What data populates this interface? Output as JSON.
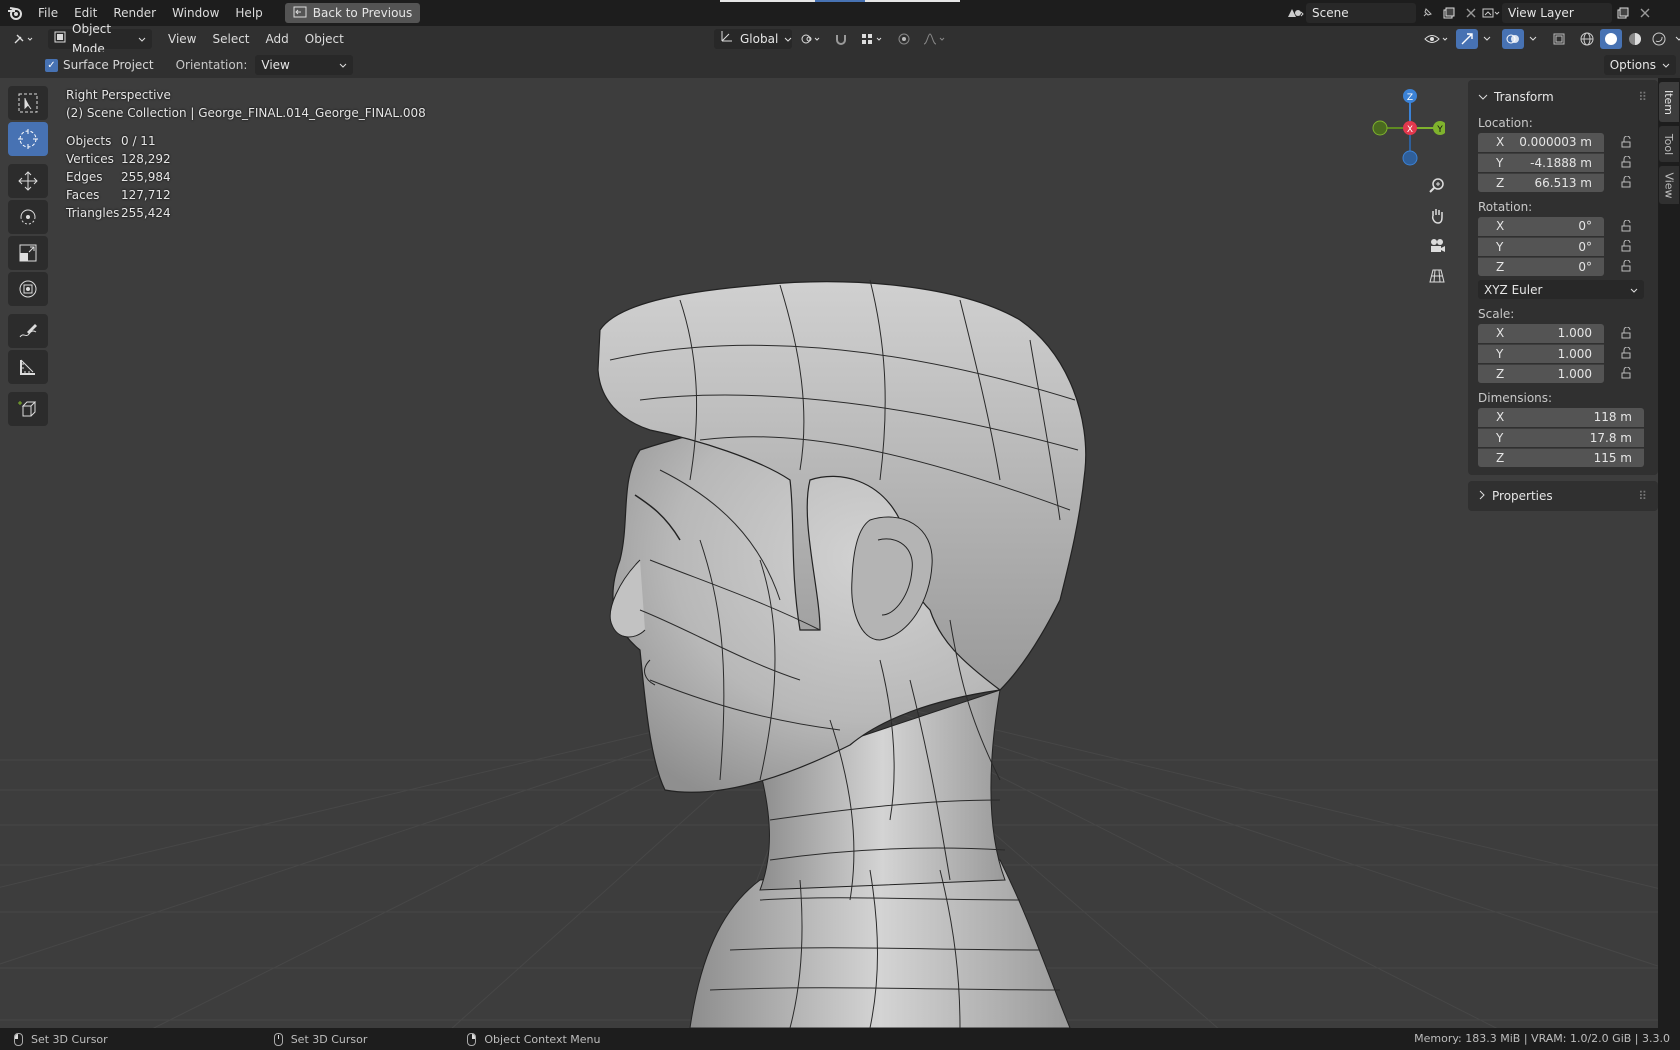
{
  "menu": {
    "items": [
      "File",
      "Edit",
      "Render",
      "Window",
      "Help"
    ],
    "back_button": "Back to Previous"
  },
  "scene": {
    "name": "Scene"
  },
  "view_layer": {
    "name": "View Layer"
  },
  "viewport_header": {
    "mode": "Object Mode",
    "menus": [
      "View",
      "Select",
      "Add",
      "Object"
    ],
    "transform_orientation": "Global"
  },
  "tool_options": {
    "surface_project_label": "Surface Project",
    "surface_project_checked": true,
    "orientation_label": "Orientation:",
    "orientation_value": "View",
    "options_label": "Options"
  },
  "overlay": {
    "view_name": "Right Perspective",
    "collection_info": "(2) Scene Collection | George_FINAL.014_George_FINAL.008",
    "stats": [
      {
        "label": "Objects",
        "value": "0 / 11"
      },
      {
        "label": "Vertices",
        "value": "128,292"
      },
      {
        "label": "Edges",
        "value": "255,984"
      },
      {
        "label": "Faces",
        "value": "127,712"
      },
      {
        "label": "Triangles",
        "value": "255,424"
      }
    ]
  },
  "gizmo": {
    "x": "X",
    "y": "Y",
    "z": "Z"
  },
  "npanel": {
    "title": "Transform",
    "location_label": "Location:",
    "location": [
      {
        "axis": "X",
        "value": "0.000003 m"
      },
      {
        "axis": "Y",
        "value": "-4.1888 m"
      },
      {
        "axis": "Z",
        "value": "66.513 m"
      }
    ],
    "rotation_label": "Rotation:",
    "rotation": [
      {
        "axis": "X",
        "value": "0°"
      },
      {
        "axis": "Y",
        "value": "0°"
      },
      {
        "axis": "Z",
        "value": "0°"
      }
    ],
    "rotation_mode": "XYZ Euler",
    "scale_label": "Scale:",
    "scale": [
      {
        "axis": "X",
        "value": "1.000"
      },
      {
        "axis": "Y",
        "value": "1.000"
      },
      {
        "axis": "Z",
        "value": "1.000"
      }
    ],
    "dimensions_label": "Dimensions:",
    "dimensions": [
      {
        "axis": "X",
        "value": "118 m"
      },
      {
        "axis": "Y",
        "value": "17.8 m"
      },
      {
        "axis": "Z",
        "value": "115 m"
      }
    ],
    "properties_title": "Properties"
  },
  "tabs": [
    "Item",
    "Tool",
    "View"
  ],
  "statusbar": {
    "left_click": "Set 3D Cursor",
    "middle_click": "Set 3D Cursor",
    "right_click": "Object Context Menu",
    "info": "Memory: 183.3 MiB | VRAM: 1.0/2.0 GiB | 3.3.0"
  },
  "colors": {
    "accent": "#4772b3",
    "axis_x": "#e2384d",
    "axis_y": "#7fb22d",
    "axis_z": "#3b82d6",
    "viewport_bg": "#3d3d3d"
  }
}
